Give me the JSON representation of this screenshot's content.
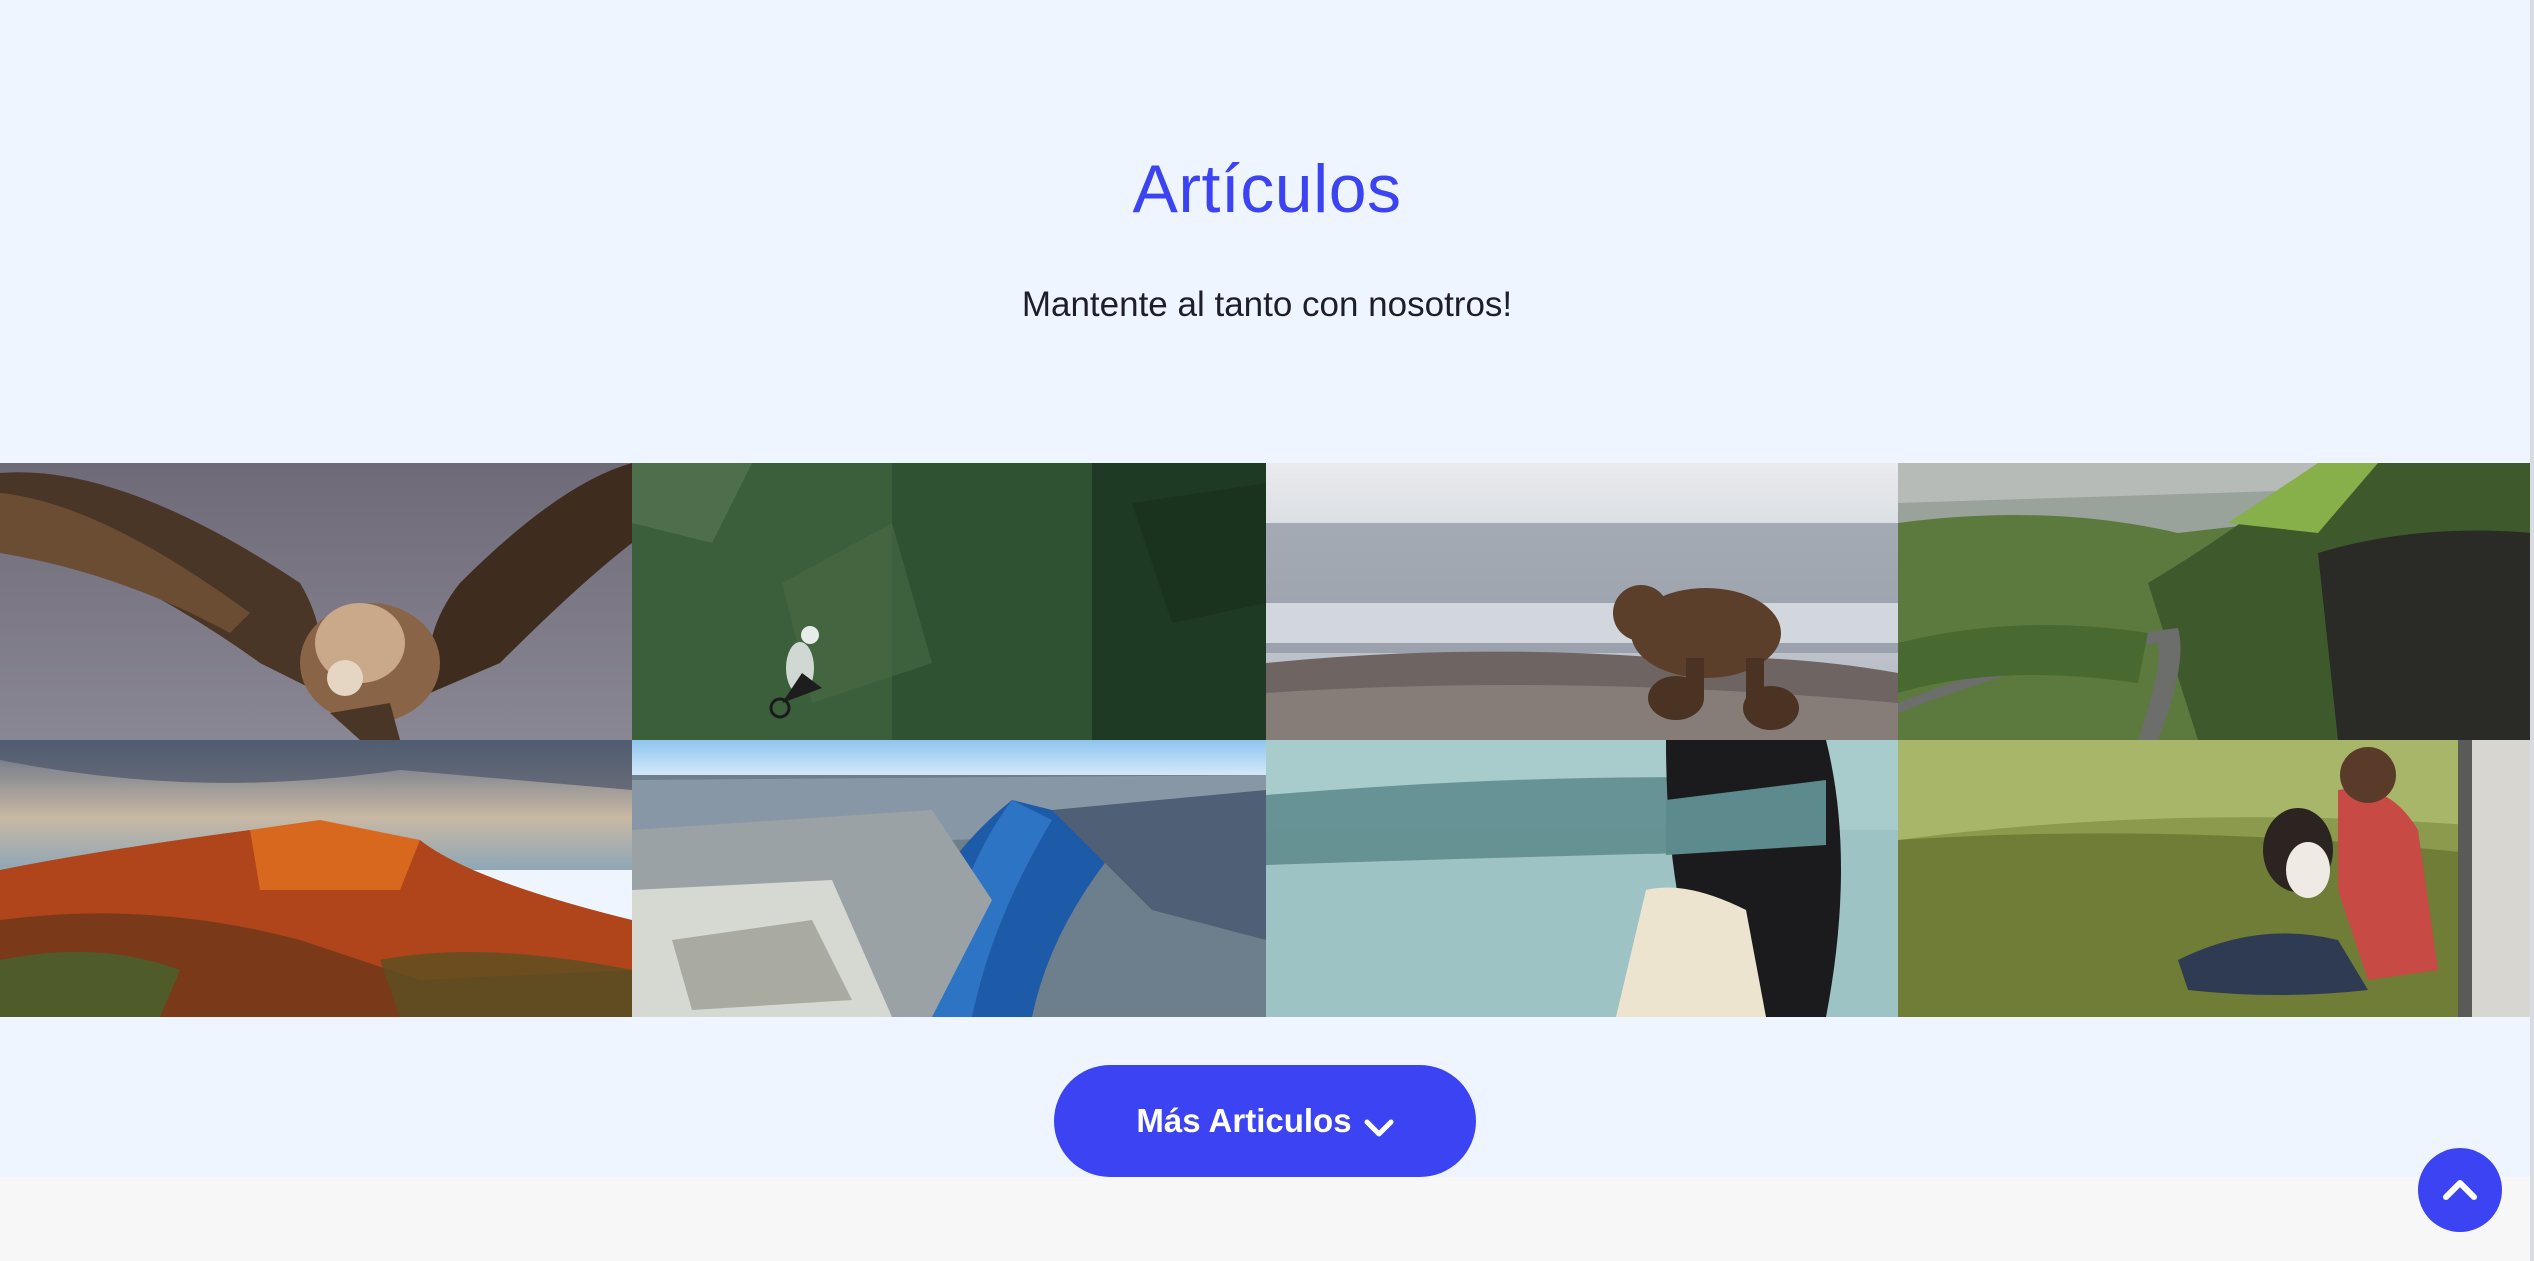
{
  "section": {
    "title": "Artículos",
    "subtitle": "Mantente al tanto con nosotros!"
  },
  "articles": [
    {
      "image": "vulture-spreading-wings"
    },
    {
      "image": "mountain-biker-in-forest"
    },
    {
      "image": "bear-with-cubs-in-snow"
    },
    {
      "image": "green-hills-winding-road"
    },
    {
      "image": "orange-canyon-cliffs"
    },
    {
      "image": "blue-fjord-from-cliff"
    },
    {
      "image": "blindfolded-woman-by-sea"
    },
    {
      "image": "man-with-dog-in-grass"
    }
  ],
  "more_button": {
    "label": "Más Articulos",
    "icon": "chevron-down-icon"
  },
  "scroll_top": {
    "icon": "chevron-up-icon"
  },
  "colors": {
    "accent": "#3b43f2",
    "section_bg": "#eef5ff",
    "page_bg": "#f7f7f8",
    "text": "#1e1e28"
  }
}
